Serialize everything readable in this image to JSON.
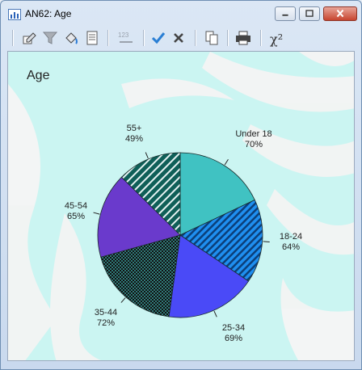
{
  "window": {
    "title": "AN62: Age"
  },
  "toolbar": {
    "icons": [
      "edit-icon",
      "filter-icon",
      "paint-bucket-icon",
      "document-icon",
      "numbers-123-icon",
      "checkmark-icon",
      "close-x-icon",
      "copy-icon",
      "print-icon",
      "chi-square-icon"
    ],
    "numbers_label": "123",
    "chi_label": "χ²"
  },
  "colors": {
    "background_pattern": "#cbf5f2",
    "slice_under18": "#40c2c2",
    "slice_18_24": "#1f8ff0",
    "slice_25_34": "#4a4af7",
    "slice_35_44": "#256e6e",
    "slice_45_54": "#6a3acc",
    "slice_55_plus": "#0f5f58"
  },
  "chart_data": {
    "type": "pie",
    "title": "Age",
    "slices": [
      {
        "label": "Under 18",
        "value": 70,
        "display": "70%"
      },
      {
        "label": "18-24",
        "value": 64,
        "display": "64%"
      },
      {
        "label": "25-34",
        "value": 69,
        "display": "69%"
      },
      {
        "label": "35-44",
        "value": 72,
        "display": "72%"
      },
      {
        "label": "45-54",
        "value": 65,
        "display": "65%"
      },
      {
        "label": "55+",
        "value": 49,
        "display": "49%"
      }
    ],
    "legend": "none",
    "grid": false
  }
}
